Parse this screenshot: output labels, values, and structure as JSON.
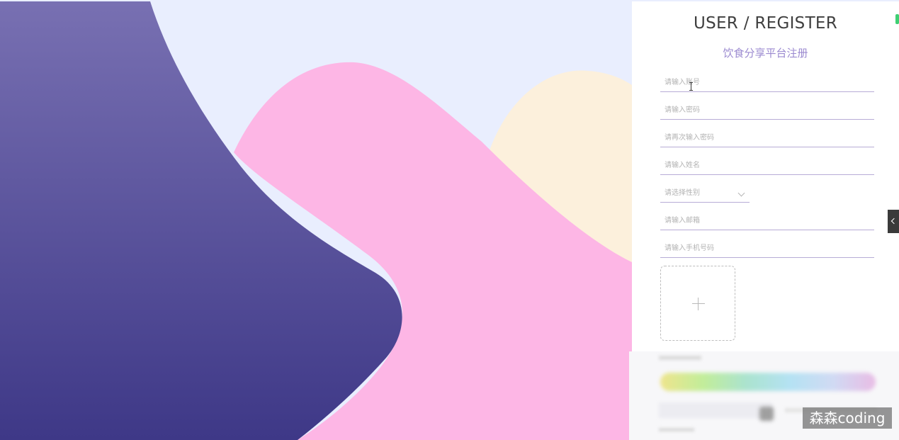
{
  "register": {
    "title": "USER / REGISTER",
    "subtitle": "饮食分享平台注册",
    "fields": [
      {
        "placeholder": "请输入账号"
      },
      {
        "placeholder": "请输入密码"
      },
      {
        "placeholder": "请再次输入密码"
      },
      {
        "placeholder": "请输入姓名"
      },
      {
        "placeholder": "请选择性别"
      },
      {
        "placeholder": "请输入邮箱"
      },
      {
        "placeholder": "请输入手机号码"
      }
    ]
  },
  "watermark": "森森coding",
  "colors": {
    "background": "#e9eefe",
    "purple_wave": "#5a50a0",
    "pink_wave": "#fdb6e5",
    "cream_wave": "#fcf0dc",
    "accent": "#9b8ad0"
  },
  "icons": {
    "upload": "plus-icon",
    "select": "chevron-down-icon",
    "side_toggle": "chevron-left-icon"
  }
}
